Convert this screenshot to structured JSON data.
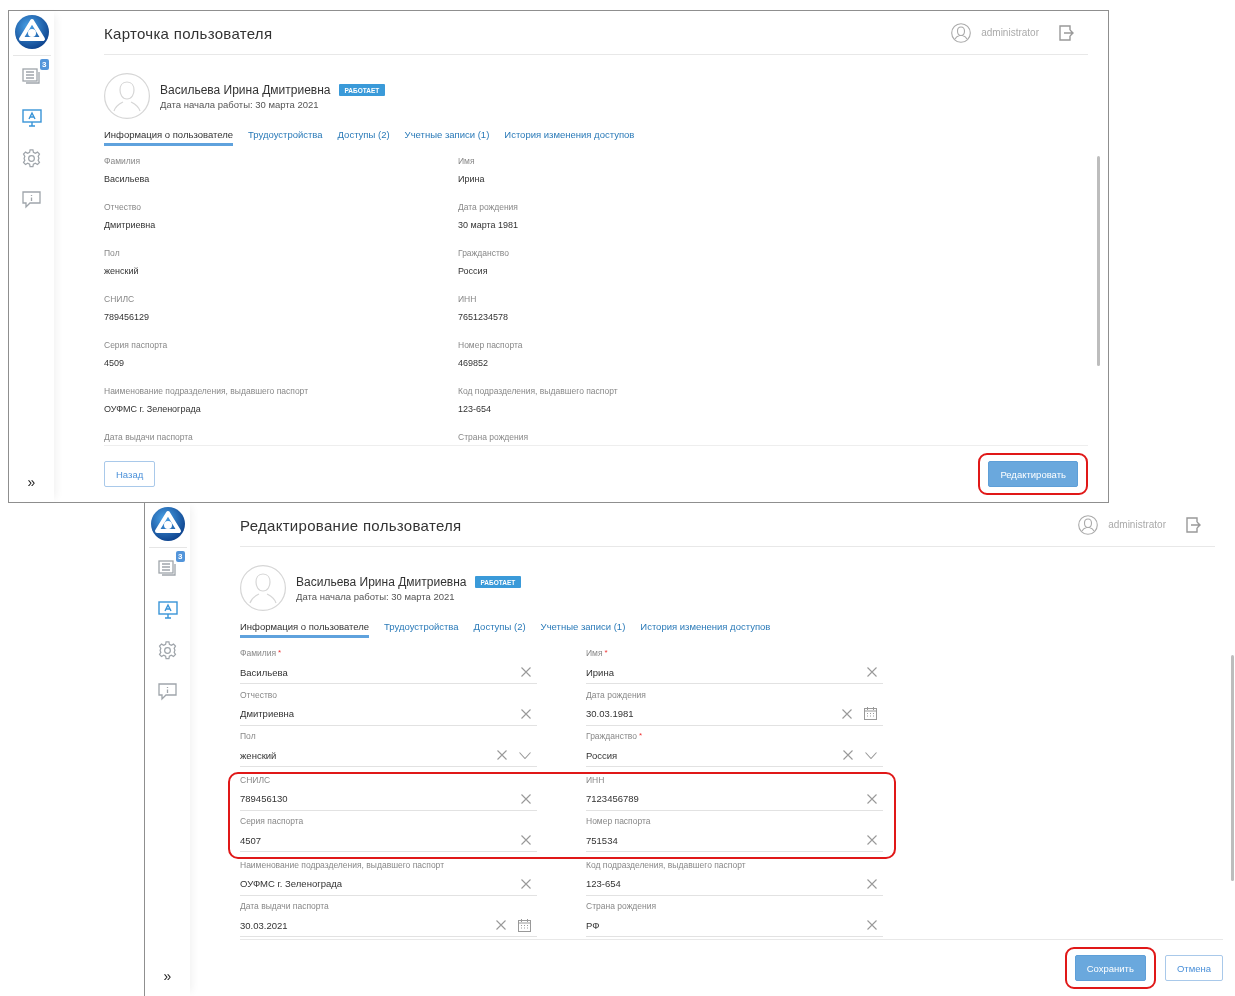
{
  "screens": [
    {
      "kind": "view",
      "title": "Карточка пользователя",
      "user": "administrator",
      "sidebar": {
        "items": [
          {
            "kind": "documents",
            "selected": false,
            "badge": "3"
          },
          {
            "kind": "monitor",
            "selected": true
          },
          {
            "kind": "settings",
            "selected": false
          },
          {
            "kind": "feedback",
            "selected": false
          }
        ],
        "expand": "»"
      },
      "profile": {
        "name": "Васильева Ирина Дмитриевна",
        "status": "РАБОТАЕТ",
        "start_date": "Дата начала работы: 30 марта 2021"
      },
      "tabs": [
        {
          "label": "Информация о пользователе",
          "selected": true
        },
        {
          "label": "Трудоустройства",
          "selected": false
        },
        {
          "label": "Доступы (2)",
          "selected": false
        },
        {
          "label": "Учетные записи (1)",
          "selected": false
        },
        {
          "label": "История изменения доступов",
          "selected": false
        }
      ],
      "rows": [
        {
          "highlighted": false,
          "fields": [
            {
              "label": "Фамилия",
              "value": "Васильева"
            },
            {
              "label": "Имя",
              "value": "Ирина"
            }
          ]
        },
        {
          "highlighted": false,
          "fields": [
            {
              "label": "Отчество",
              "value": "Дмитриевна"
            },
            {
              "label": "Дата рождения",
              "value": "30 марта 1981"
            }
          ]
        },
        {
          "highlighted": false,
          "fields": [
            {
              "label": "Пол",
              "value": "женский"
            },
            {
              "label": "Гражданство",
              "value": "Россия"
            }
          ]
        },
        {
          "highlighted": false,
          "fields": [
            {
              "label": "СНИЛС",
              "value": "789456129"
            },
            {
              "label": "ИНН",
              "value": "7651234578"
            }
          ]
        },
        {
          "highlighted": false,
          "fields": [
            {
              "label": "Серия паспорта",
              "value": "4509"
            },
            {
              "label": "Номер паспорта",
              "value": "469852"
            }
          ]
        },
        {
          "highlighted": false,
          "fields": [
            {
              "label": "Наименование подразделения, выдавшего паспорт",
              "value": "ОУФМС г. Зеленограда"
            },
            {
              "label": "Код подразделения, выдавшего паспорт",
              "value": "123-654"
            }
          ]
        },
        {
          "highlighted": false,
          "fields": [
            {
              "label": "Дата выдачи паспорта"
            },
            {
              "label": "Страна рождения"
            }
          ]
        }
      ],
      "buttons": [
        {
          "label": "Назад",
          "kind": "secondary",
          "highlighted": false
        },
        {
          "label": "Редактировать",
          "kind": "primary",
          "highlighted": true
        }
      ]
    },
    {
      "kind": "edit",
      "title": "Редактирование пользователя",
      "user": "administrator",
      "sidebar": {
        "items": [
          {
            "kind": "documents",
            "selected": false,
            "badge": "3"
          },
          {
            "kind": "monitor",
            "selected": true
          },
          {
            "kind": "settings",
            "selected": false
          },
          {
            "kind": "feedback",
            "selected": false
          }
        ],
        "expand": "»"
      },
      "profile": {
        "name": "Васильева Ирина Дмитриевна",
        "status": "РАБОТАЕТ",
        "start_date": "Дата начала работы: 30 марта 2021"
      },
      "tabs": [
        {
          "label": "Информация о пользователе",
          "selected": true
        },
        {
          "label": "Трудоустройства",
          "selected": false
        },
        {
          "label": "Доступы (2)",
          "selected": false
        },
        {
          "label": "Учетные записи (1)",
          "selected": false
        },
        {
          "label": "История изменения доступов",
          "selected": false
        }
      ],
      "rows": [
        {
          "highlighted": false,
          "fields": [
            {
              "label": "Фамилия",
              "value": "Васильева",
              "kind": "text",
              "required_mark": "*"
            },
            {
              "label": "Имя",
              "value": "Ирина",
              "kind": "text",
              "required_mark": "*"
            }
          ]
        },
        {
          "highlighted": false,
          "fields": [
            {
              "label": "Отчество",
              "value": "Дмитриевна",
              "kind": "text"
            },
            {
              "label": "Дата рождения",
              "value": "30.03.1981",
              "kind": "date"
            }
          ]
        },
        {
          "highlighted": false,
          "fields": [
            {
              "label": "Пол",
              "value": "женский",
              "kind": "select"
            },
            {
              "label": "Гражданство",
              "value": "Россия",
              "kind": "select",
              "required_mark": "*"
            }
          ]
        },
        {
          "highlighted": true,
          "fields": [
            {
              "label": "СНИЛС",
              "value": "789456130",
              "kind": "text"
            },
            {
              "label": "ИНН",
              "value": "7123456789",
              "kind": "text"
            }
          ]
        },
        {
          "highlighted": true,
          "fields": [
            {
              "label": "Серия паспорта",
              "value": "4507",
              "kind": "text"
            },
            {
              "label": "Номер паспорта",
              "value": "751534",
              "kind": "text"
            }
          ]
        },
        {
          "highlighted": false,
          "fields": [
            {
              "label": "Наименование подразделения, выдавшего паспорт",
              "value": "ОУФМС г. Зеленограда",
              "kind": "text"
            },
            {
              "label": "Код подразделения, выдавшего паспорт",
              "value": "123-654",
              "kind": "text"
            }
          ]
        },
        {
          "highlighted": false,
          "fields": [
            {
              "label": "Дата выдачи паспорта",
              "value": "30.03.2021",
              "kind": "date"
            },
            {
              "label": "Страна рождения",
              "value": "РФ",
              "kind": "text"
            }
          ]
        }
      ],
      "buttons": [
        {
          "label": "Сохранить",
          "kind": "primary",
          "highlighted": true
        },
        {
          "label": "Отмена",
          "kind": "secondary",
          "highlighted": false
        }
      ]
    }
  ]
}
